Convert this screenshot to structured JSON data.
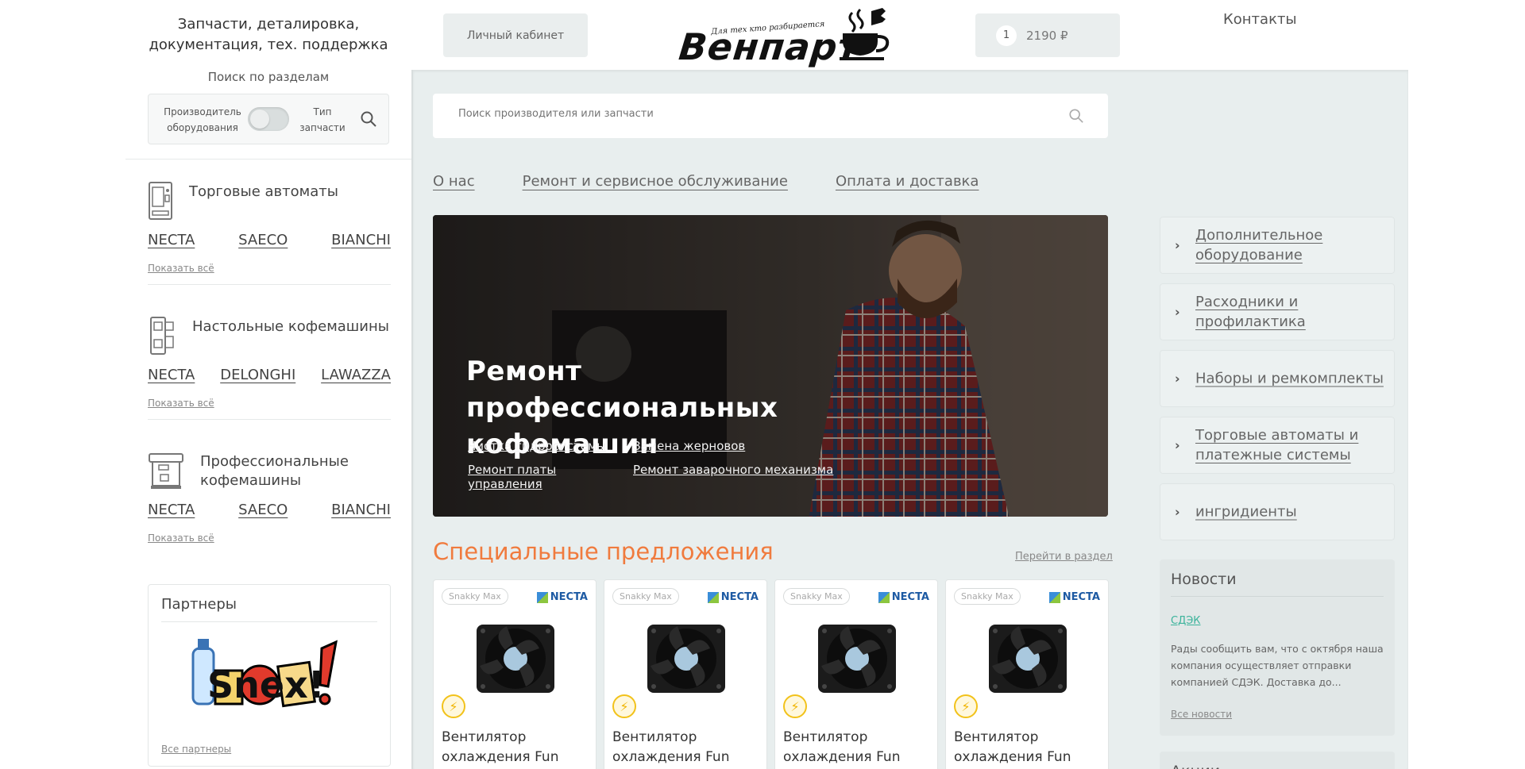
{
  "header": {
    "tagline": "Запчасти, деталировка, документация, тех. поддержка",
    "cabinet_label": "Личный кабинет",
    "logo_small": "Для тех кто разбирается",
    "logo_brand": "Венпарт",
    "cart_count": "1",
    "cart_sum": "2190 ₽",
    "contacts_label": "Контакты"
  },
  "sidebar": {
    "search_title": "Поиск по разделам",
    "toggle_left": "Производитель оборудования",
    "toggle_right": "Тип запчасти",
    "categories": [
      {
        "title": "Торговые автоматы",
        "brands": [
          "NECTA",
          "SAECO",
          "BIANCHI"
        ],
        "show_all": "Показать всё",
        "icon": "vending-machine-icon"
      },
      {
        "title": "Настольные кофемашины",
        "brands": [
          "NECTA",
          "DELONGHI",
          "LAWAZZA"
        ],
        "show_all": "Показать всё",
        "icon": "coffee-maker-icon"
      },
      {
        "title": "Профессиональные кофемашины",
        "brands": [
          "NECTA",
          "SAECO",
          "BIANCHI"
        ],
        "show_all": "Показать всё",
        "icon": "espresso-machine-icon"
      }
    ],
    "partners_title": "Партнеры",
    "partners_logo": "Snex!",
    "partners_all": "Все партнеры"
  },
  "main": {
    "search_placeholder": "Поиск производителя или запчасти",
    "nav": [
      "О нас",
      "Ремонт и сервисное обслуживание",
      "Оплата и доставка"
    ],
    "hero": {
      "title": "Ремонт профессиональных кофемашин",
      "links": [
        "Чистка гидросистемы",
        "Замена жерновов",
        "Ремонт платы управления",
        "Ремонт заварочного механизма"
      ]
    },
    "special_title": "Специальные предложения",
    "special_link": "Перейти в раздел",
    "cards": [
      {
        "badge": "Snakky Max",
        "brand": "NECTA",
        "name": "Вентилятор охлаждения Fun"
      },
      {
        "badge": "Snakky Max",
        "brand": "NECTA",
        "name": "Вентилятор охлаждения Fun"
      },
      {
        "badge": "Snakky Max",
        "brand": "NECTA",
        "name": "Вентилятор охлаждения Fun"
      },
      {
        "badge": "Snakky Max",
        "brand": "NECTA",
        "name": "Вентилятор охлаждения Fun"
      }
    ]
  },
  "right": {
    "categories": [
      "Дополнительное оборудование",
      "Расходники и профилактика",
      "Наборы и ремкомплекты",
      "Торговые автоматы и платежные системы",
      "ингридиенты"
    ],
    "news_title": "Новости",
    "news_item": "СДЭК",
    "news_text": "Рады сообщить вам, что с октября наша компания осуществляет отправки компанией СДЭК. Доставка до...",
    "news_all": "Все новости",
    "promo_title": "Акции"
  },
  "colors": {
    "accent": "#f07b3e",
    "link_green": "#3bb39b",
    "panel_bg": "#e8eeee"
  }
}
